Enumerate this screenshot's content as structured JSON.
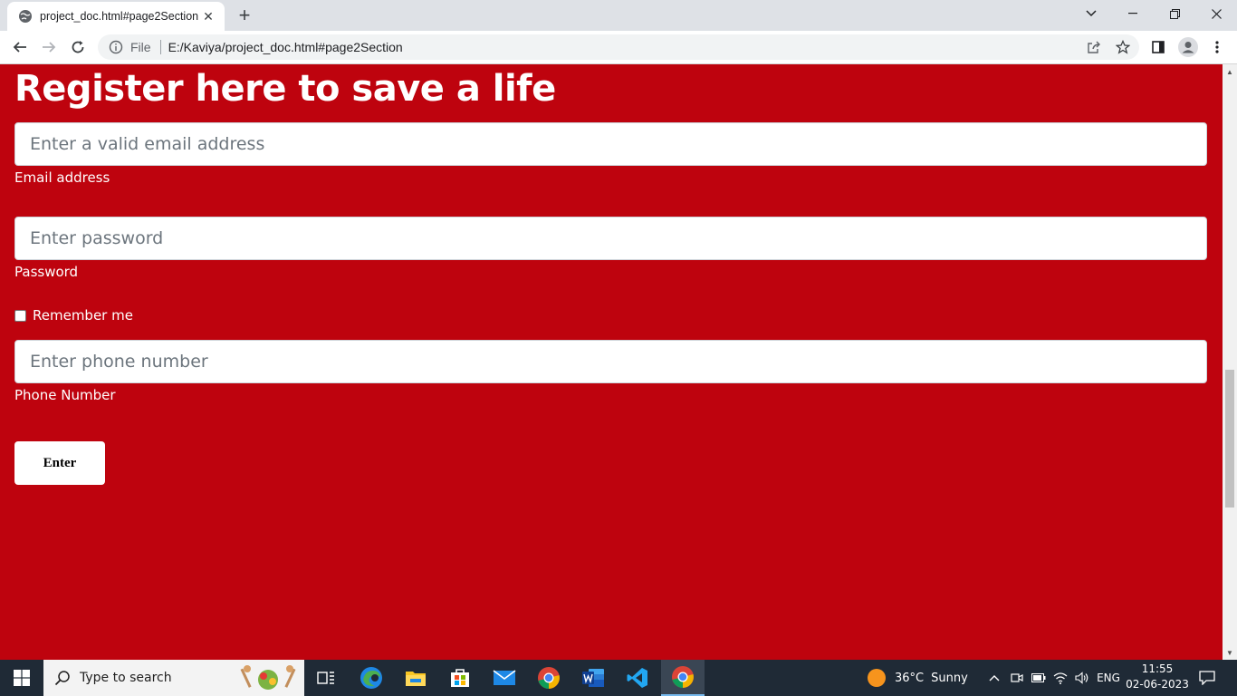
{
  "browser": {
    "tab_title": "project_doc.html#page2Section",
    "omnibox_scheme_label": "File",
    "url": "E:/Kaviya/project_doc.html#page2Section"
  },
  "form": {
    "heading": "Register here to save a life",
    "email": {
      "placeholder": "Enter a valid email address",
      "label": "Email address",
      "value": ""
    },
    "password": {
      "placeholder": "Enter password",
      "label": "Password",
      "value": ""
    },
    "remember": {
      "label": "Remember me",
      "checked": false
    },
    "phone": {
      "placeholder": "Enter phone number",
      "label": "Phone Number",
      "value": ""
    },
    "submit_label": "Enter"
  },
  "taskbar": {
    "search_placeholder": "Type to search",
    "weather": {
      "temp": "36°C",
      "condition": "Sunny"
    },
    "language": "ENG",
    "time": "11:55",
    "date": "02-06-2023",
    "apps": [
      "task-view",
      "edge",
      "file-explorer",
      "microsoft-store",
      "mail",
      "chrome",
      "word",
      "vscode",
      "chrome-active"
    ]
  },
  "colors": {
    "page_background": "#be030e",
    "taskbar": "#1f2a36"
  }
}
